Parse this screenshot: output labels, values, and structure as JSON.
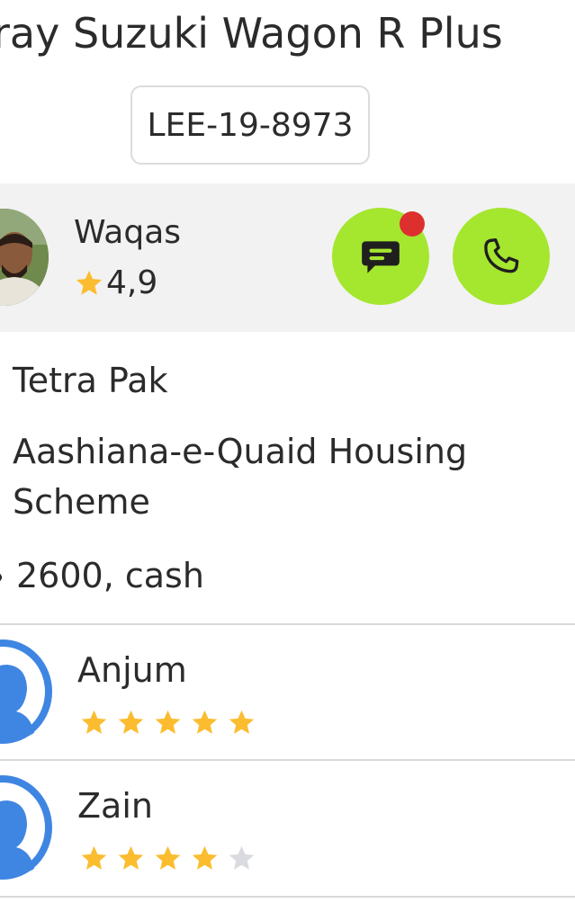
{
  "vehicle": {
    "title": "ray Suzuki Wagon R Plus",
    "plate": "LEE-19-8973"
  },
  "driver": {
    "name": "Waqas",
    "rating": "4,9",
    "chat_button_icon": "chat-icon",
    "call_button_icon": "phone-icon",
    "has_unread_message": true
  },
  "trip": {
    "pickup": "Tetra Pak",
    "dropoff": "Aashiana-e-Quaid Housing Scheme",
    "fare": "2600, cash"
  },
  "passengers": [
    {
      "name": "Anjum",
      "stars": 5
    },
    {
      "name": "Zain",
      "stars": 4
    }
  ],
  "colors": {
    "accent_green": "#a5e62f",
    "notification_red": "#de2f2f",
    "star_gold": "#fbbd2f",
    "star_empty": "#d9dbe0",
    "avatar_blue": "#3f86e3"
  }
}
